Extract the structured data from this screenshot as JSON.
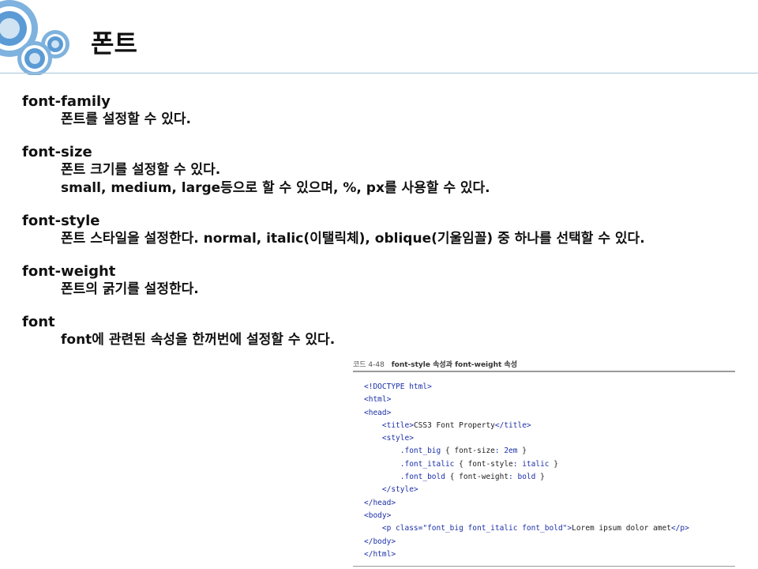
{
  "slide": {
    "title": "폰트"
  },
  "properties": [
    {
      "name": "font-family",
      "lines": [
        "폰트를 설정할 수 있다."
      ]
    },
    {
      "name": "font-size",
      "lines": [
        "폰트 크기를 설정할 수 있다.",
        "small, medium, large등으로 할 수 있으며, %, px를 사용할 수 있다."
      ]
    },
    {
      "name": "font-style",
      "lines": [
        "폰트 스타일을 설정한다. normal, italic(이탤릭체), oblique(기울임꼴) 중 하나를 선택할 수 있다."
      ]
    },
    {
      "name": "font-weight",
      "lines": [
        "폰트의 굵기를 설정한다."
      ]
    },
    {
      "name": "font",
      "lines": [
        "font에 관련된 속성을 한꺼번에 설정할 수 있다."
      ]
    }
  ],
  "code_figure": {
    "number": "코드 4-48",
    "title": "font-style 속성과 font-weight 속성",
    "lines": [
      "<!DOCTYPE html>",
      "<html>",
      "<head>",
      "    <title>CSS3 Font Property</title>",
      "    <style>",
      "        .font_big { font-size: 2em }",
      "        .font_italic { font-style: italic }",
      "        .font_bold { font-weight: bold }",
      "    </style>",
      "</head>",
      "<body>",
      "    <p class=\"font_big font_italic font_bold\">Lorem ipsum dolor amet</p>",
      "</body>",
      "</html>"
    ]
  },
  "colors": {
    "accent_circle_outer": "#5b9bd5",
    "accent_circle_light": "#cfe3f3",
    "rule": "#a8c6d8",
    "code_tag": "#1b2fa8",
    "code_property": "#b0186a"
  },
  "icons": [
    "decorative-circles-icon"
  ]
}
